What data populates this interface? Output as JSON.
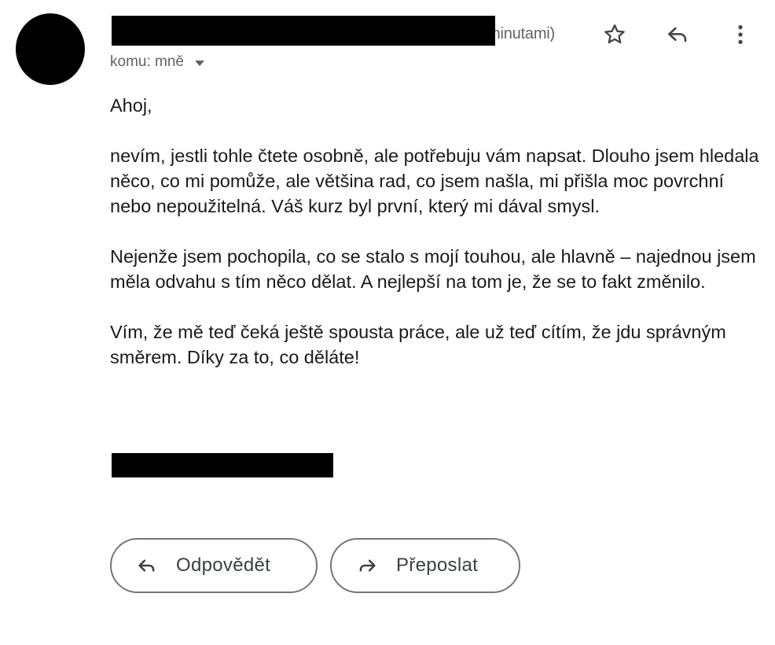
{
  "header": {
    "time_fragment": "minutami)",
    "recipient_label": "komu: mně"
  },
  "icons": {
    "star": "star-icon",
    "reply": "reply-icon",
    "more": "more-vert-icon",
    "forward": "forward-icon",
    "dropdown": "caret-down-icon"
  },
  "message": {
    "greeting": "Ahoj,",
    "paragraphs": [
      "nevím, jestli tohle čtete osobně, ale potřebuju vám napsat. Dlouho jsem hledala něco, co mi pomůže, ale většina rad, co jsem našla, mi přišla moc povrchní nebo nepoužitelná. Váš kurz byl první, který mi dával smysl.",
      "Nejenže jsem pochopila, co se stalo s mojí touhou, ale hlavně – najednou jsem měla odvahu s tím něco dělat. A nejlepší na tom je, že se to fakt změnilo.",
      "Vím, že mě teď čeká ještě spousta práce, ale už teď cítím, že jdu správným směrem. Díky za to, co děláte!"
    ]
  },
  "actions": {
    "reply_label": "Odpovědět",
    "forward_label": "Přeposlat"
  },
  "colors": {
    "text": "#1a1a1a",
    "secondary": "#5f6368",
    "border": "#747775",
    "redaction": "#000000"
  }
}
